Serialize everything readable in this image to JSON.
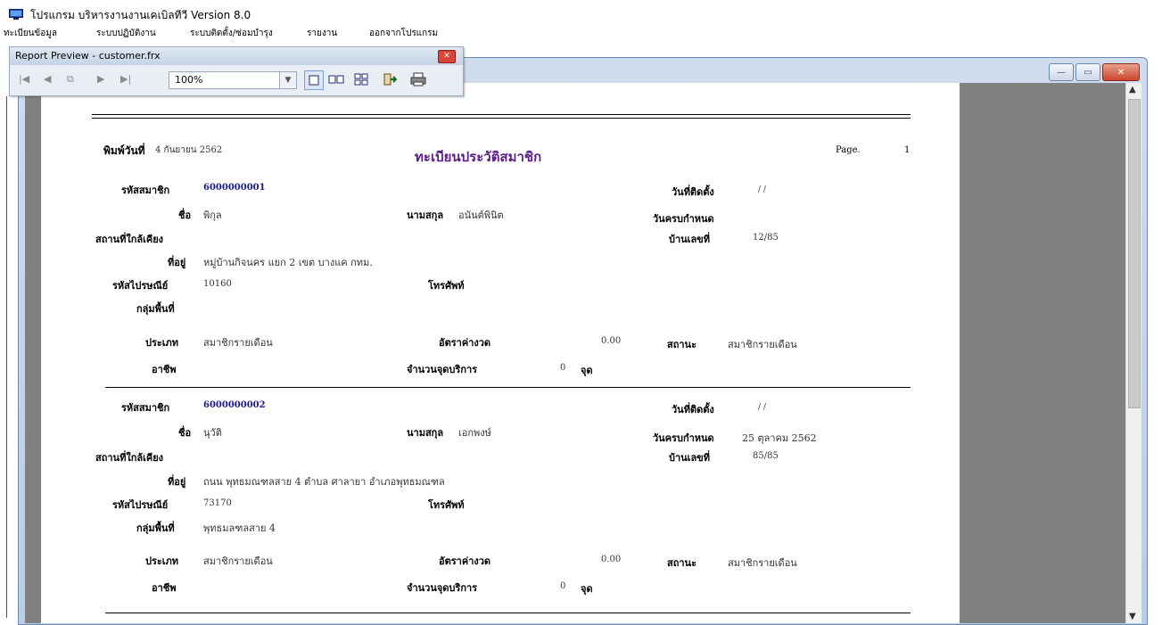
{
  "app": {
    "title": "โปรแกรม บริหารงานงานเคเบิลทีวี Version 8.0",
    "menu": [
      "ทะเบียนข้อมูล",
      "ระบบปฏิบัติงาน",
      "ระบบติดตั้ง/ซ่อมบำรุง",
      "รายงาน",
      "ออกจากโปรแกรม"
    ]
  },
  "preview_toolbar": {
    "title": "Report Preview - customer.frx",
    "zoom": "100%",
    "icons": [
      "first-page-icon",
      "prev-page-icon",
      "goto-page-icon",
      "next-page-icon",
      "last-page-icon",
      "one-page-icon",
      "two-pages-icon",
      "four-pages-icon",
      "close-preview-icon",
      "print-icon"
    ]
  },
  "report": {
    "print_date_label": "พิมพ์วันที่",
    "print_date": "4 กันยายน 2562",
    "title": "ทะเบียนประวัติสมาชิก",
    "page_label": "Page.",
    "page_number": "1",
    "labels": {
      "member_code": "รหัสสมาชิก",
      "install_date": "วันที่ติดตั้ง",
      "name": "ชื่อ",
      "surname": "นามสกุล",
      "due_date": "วันครบกำหนด",
      "nearby": "สถานที่ใกล้เคียง",
      "house_no": "บ้านเลขที่",
      "address": "ที่อยู่",
      "postcode": "รหัสไปรษณีย์",
      "phone": "โทรศัพท์",
      "area_group": "กลุ่มพื้นที่",
      "type": "ประเภท",
      "installment_rate": "อัตราค่างวด",
      "status": "สถานะ",
      "occupation": "อาชีพ",
      "service_points": "จำนวนจุดบริการ",
      "points_unit": "จุด"
    },
    "records": [
      {
        "member_code": "6000000001",
        "install_date": "/ /",
        "name": "พิกุล",
        "surname": "อนันต์พินิต",
        "due_date": "",
        "nearby": "",
        "house_no": "12/85",
        "address": "หมู่บ้านกิจนคร แยก 2 เขต บางแค กทม.",
        "postcode": "10160",
        "phone": "",
        "area_group": "",
        "type": "สมาชิกรายเดือน",
        "installment_rate": "0.00",
        "status": "สมาชิกรายเดือน",
        "occupation": "",
        "service_points": "0"
      },
      {
        "member_code": "6000000002",
        "install_date": "/ /",
        "name": "นุวัติ",
        "surname": "เอกพงษ์",
        "due_date": "25 ตุลาคม 2562",
        "nearby": "",
        "house_no": "85/85",
        "address": "ถนน พุทธมณฑลสาย 4 ตำบล ศาลายา อำเภอพุทธมณฑล",
        "postcode": "73170",
        "phone": "",
        "area_group": "พุทธมลฑลสาย 4",
        "type": "สมาชิกรายเดือน",
        "installment_rate": "0.00",
        "status": "สมาชิกรายเดือน",
        "occupation": "",
        "service_points": "0"
      }
    ]
  }
}
